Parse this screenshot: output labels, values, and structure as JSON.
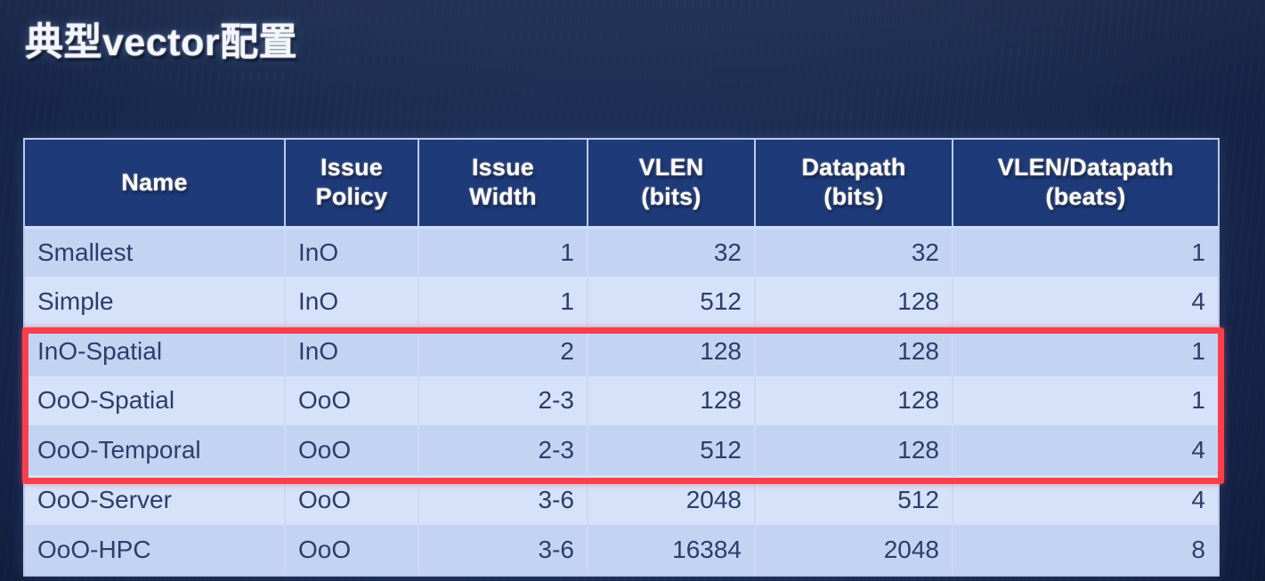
{
  "slide": {
    "title": "典型vector配置",
    "background_color": "#1a2b4e",
    "accent_color": "#fa3f4c",
    "header_color": "#1e3a78"
  },
  "table": {
    "columns": [
      {
        "id": "name",
        "label": "Name"
      },
      {
        "id": "policy",
        "label_line1": "Issue",
        "label_line2": "Policy"
      },
      {
        "id": "width",
        "label_line1": "Issue",
        "label_line2": "Width"
      },
      {
        "id": "vlen",
        "label_line1": "VLEN",
        "label_line2": "(bits)"
      },
      {
        "id": "datapath",
        "label_line1": "Datapath",
        "label_line2": "(bits)"
      },
      {
        "id": "ratio",
        "label_line1": "VLEN/Datapath",
        "label_line2": "(beats)"
      }
    ],
    "rows": [
      {
        "name": "Smallest",
        "policy": "InO",
        "width": "1",
        "vlen": "32",
        "datapath": "32",
        "ratio": "1",
        "highlighted": false
      },
      {
        "name": "Simple",
        "policy": "InO",
        "width": "1",
        "vlen": "512",
        "datapath": "128",
        "ratio": "4",
        "highlighted": false
      },
      {
        "name": "InO-Spatial",
        "policy": "InO",
        "width": "2",
        "vlen": "128",
        "datapath": "128",
        "ratio": "1",
        "highlighted": true
      },
      {
        "name": "OoO-Spatial",
        "policy": "OoO",
        "width": "2-3",
        "vlen": "128",
        "datapath": "128",
        "ratio": "1",
        "highlighted": true
      },
      {
        "name": "OoO-Temporal",
        "policy": "OoO",
        "width": "2-3",
        "vlen": "512",
        "datapath": "128",
        "ratio": "4",
        "highlighted": true
      },
      {
        "name": "OoO-Server",
        "policy": "OoO",
        "width": "3-6",
        "vlen": "2048",
        "datapath": "512",
        "ratio": "4",
        "highlighted": false
      },
      {
        "name": "OoO-HPC",
        "policy": "OoO",
        "width": "3-6",
        "vlen": "16384",
        "datapath": "2048",
        "ratio": "8",
        "highlighted": false
      }
    ]
  }
}
